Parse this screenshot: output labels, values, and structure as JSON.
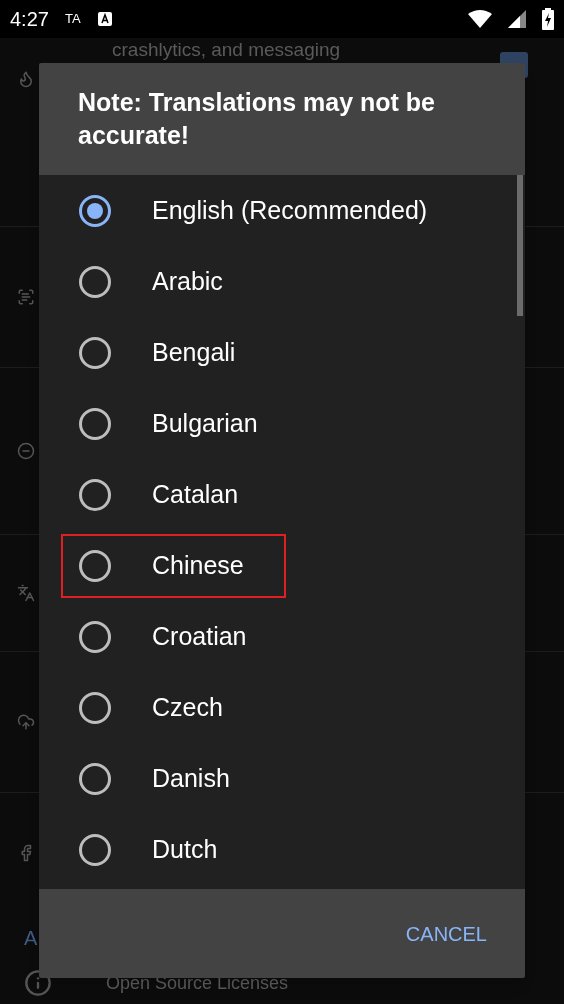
{
  "status_bar": {
    "time": "4:27",
    "indicator": "TA"
  },
  "background": {
    "top_text": "crashlytics, and messaging",
    "section_header": "A",
    "bottom_text": "Open Source Licenses",
    "checkbox_checked": true
  },
  "dialog": {
    "title": "Note: Translations may not be accurate!",
    "options": [
      {
        "label": "English (Recommended)",
        "selected": true,
        "highlighted": false
      },
      {
        "label": "Arabic",
        "selected": false,
        "highlighted": false
      },
      {
        "label": "Bengali",
        "selected": false,
        "highlighted": false
      },
      {
        "label": "Bulgarian",
        "selected": false,
        "highlighted": false
      },
      {
        "label": "Catalan",
        "selected": false,
        "highlighted": false
      },
      {
        "label": "Chinese",
        "selected": false,
        "highlighted": true
      },
      {
        "label": "Croatian",
        "selected": false,
        "highlighted": false
      },
      {
        "label": "Czech",
        "selected": false,
        "highlighted": false
      },
      {
        "label": "Danish",
        "selected": false,
        "highlighted": false
      },
      {
        "label": "Dutch",
        "selected": false,
        "highlighted": false
      }
    ],
    "cancel": "CANCEL"
  }
}
